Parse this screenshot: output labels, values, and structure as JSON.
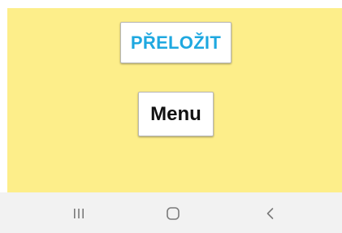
{
  "buttons": {
    "translate_label": "PŘELOŽIT",
    "menu_label": "Menu"
  },
  "navbar": {
    "icons": [
      "recent-apps-icon",
      "home-icon",
      "back-icon"
    ]
  },
  "colors": {
    "content_background": "#fdee8a",
    "translate_text": "#1fa8e0",
    "menu_text": "#111111",
    "navbar_background": "#f2f2f2",
    "navbar_icon": "#7a7a7a"
  }
}
